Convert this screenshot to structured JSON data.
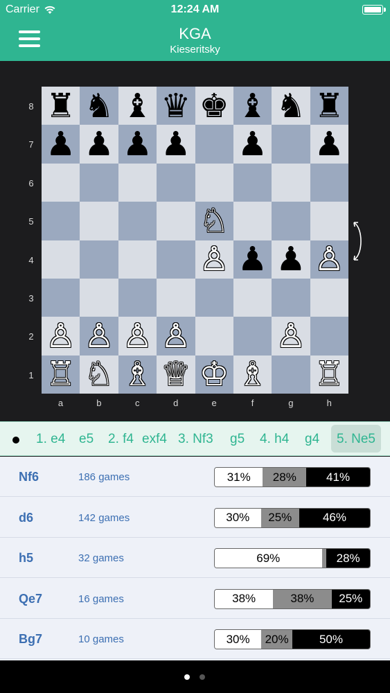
{
  "status": {
    "carrier": "Carrier",
    "time": "12:24 AM"
  },
  "header": {
    "title": "KGA",
    "subtitle": "Kieseritsky"
  },
  "icons": {
    "menu": "hamburger-menu-icon",
    "wifi": "wifi-icon",
    "battery": "battery-icon",
    "flip": "flip-board-icon"
  },
  "colors": {
    "accent": "#2fb591",
    "link": "#3c6fb2",
    "light_square": "#d9dde4",
    "dark_square": "#9ba9bf"
  },
  "board": {
    "ranks": [
      "8",
      "7",
      "6",
      "5",
      "4",
      "3",
      "2",
      "1"
    ],
    "files": [
      "a",
      "b",
      "c",
      "d",
      "e",
      "f",
      "g",
      "h"
    ],
    "rows": [
      [
        "♜",
        "♞",
        "♝",
        "♛",
        "♚",
        "♝",
        "♞",
        "♜"
      ],
      [
        "♟",
        "♟",
        "♟",
        "♟",
        "",
        "♟",
        "",
        "♟"
      ],
      [
        "",
        "",
        "",
        "",
        "",
        "",
        "",
        ""
      ],
      [
        "",
        "",
        "",
        "",
        "♘",
        "",
        "",
        ""
      ],
      [
        "",
        "",
        "",
        "",
        "♙",
        "♟",
        "♟",
        "♙"
      ],
      [
        "",
        "",
        "",
        "",
        "",
        "",
        "",
        ""
      ],
      [
        "♙",
        "♙",
        "♙",
        "♙",
        "",
        "",
        "♙",
        ""
      ],
      [
        "♖",
        "♘",
        "♗",
        "♕",
        "♔",
        "♗",
        "",
        "♖"
      ]
    ]
  },
  "moves": [
    "1. e4",
    "e5",
    "2. f4",
    "exf4",
    "3. Nf3",
    "g5",
    "4. h4",
    "g4",
    "5. Ne5"
  ],
  "stats": [
    {
      "move": "Nf6",
      "games": "186 games",
      "win": 31,
      "draw": 28,
      "loss": 41
    },
    {
      "move": "d6",
      "games": "142 games",
      "win": 30,
      "draw": 25,
      "loss": 46
    },
    {
      "move": "h5",
      "games": "32 games",
      "win": 69,
      "draw": 3,
      "loss": 28
    },
    {
      "move": "Qe7",
      "games": "16 games",
      "win": 38,
      "draw": 38,
      "loss": 25
    },
    {
      "move": "Bg7",
      "games": "10 games",
      "win": 30,
      "draw": 20,
      "loss": 50
    }
  ],
  "pager": {
    "count": 2,
    "active": 0
  }
}
